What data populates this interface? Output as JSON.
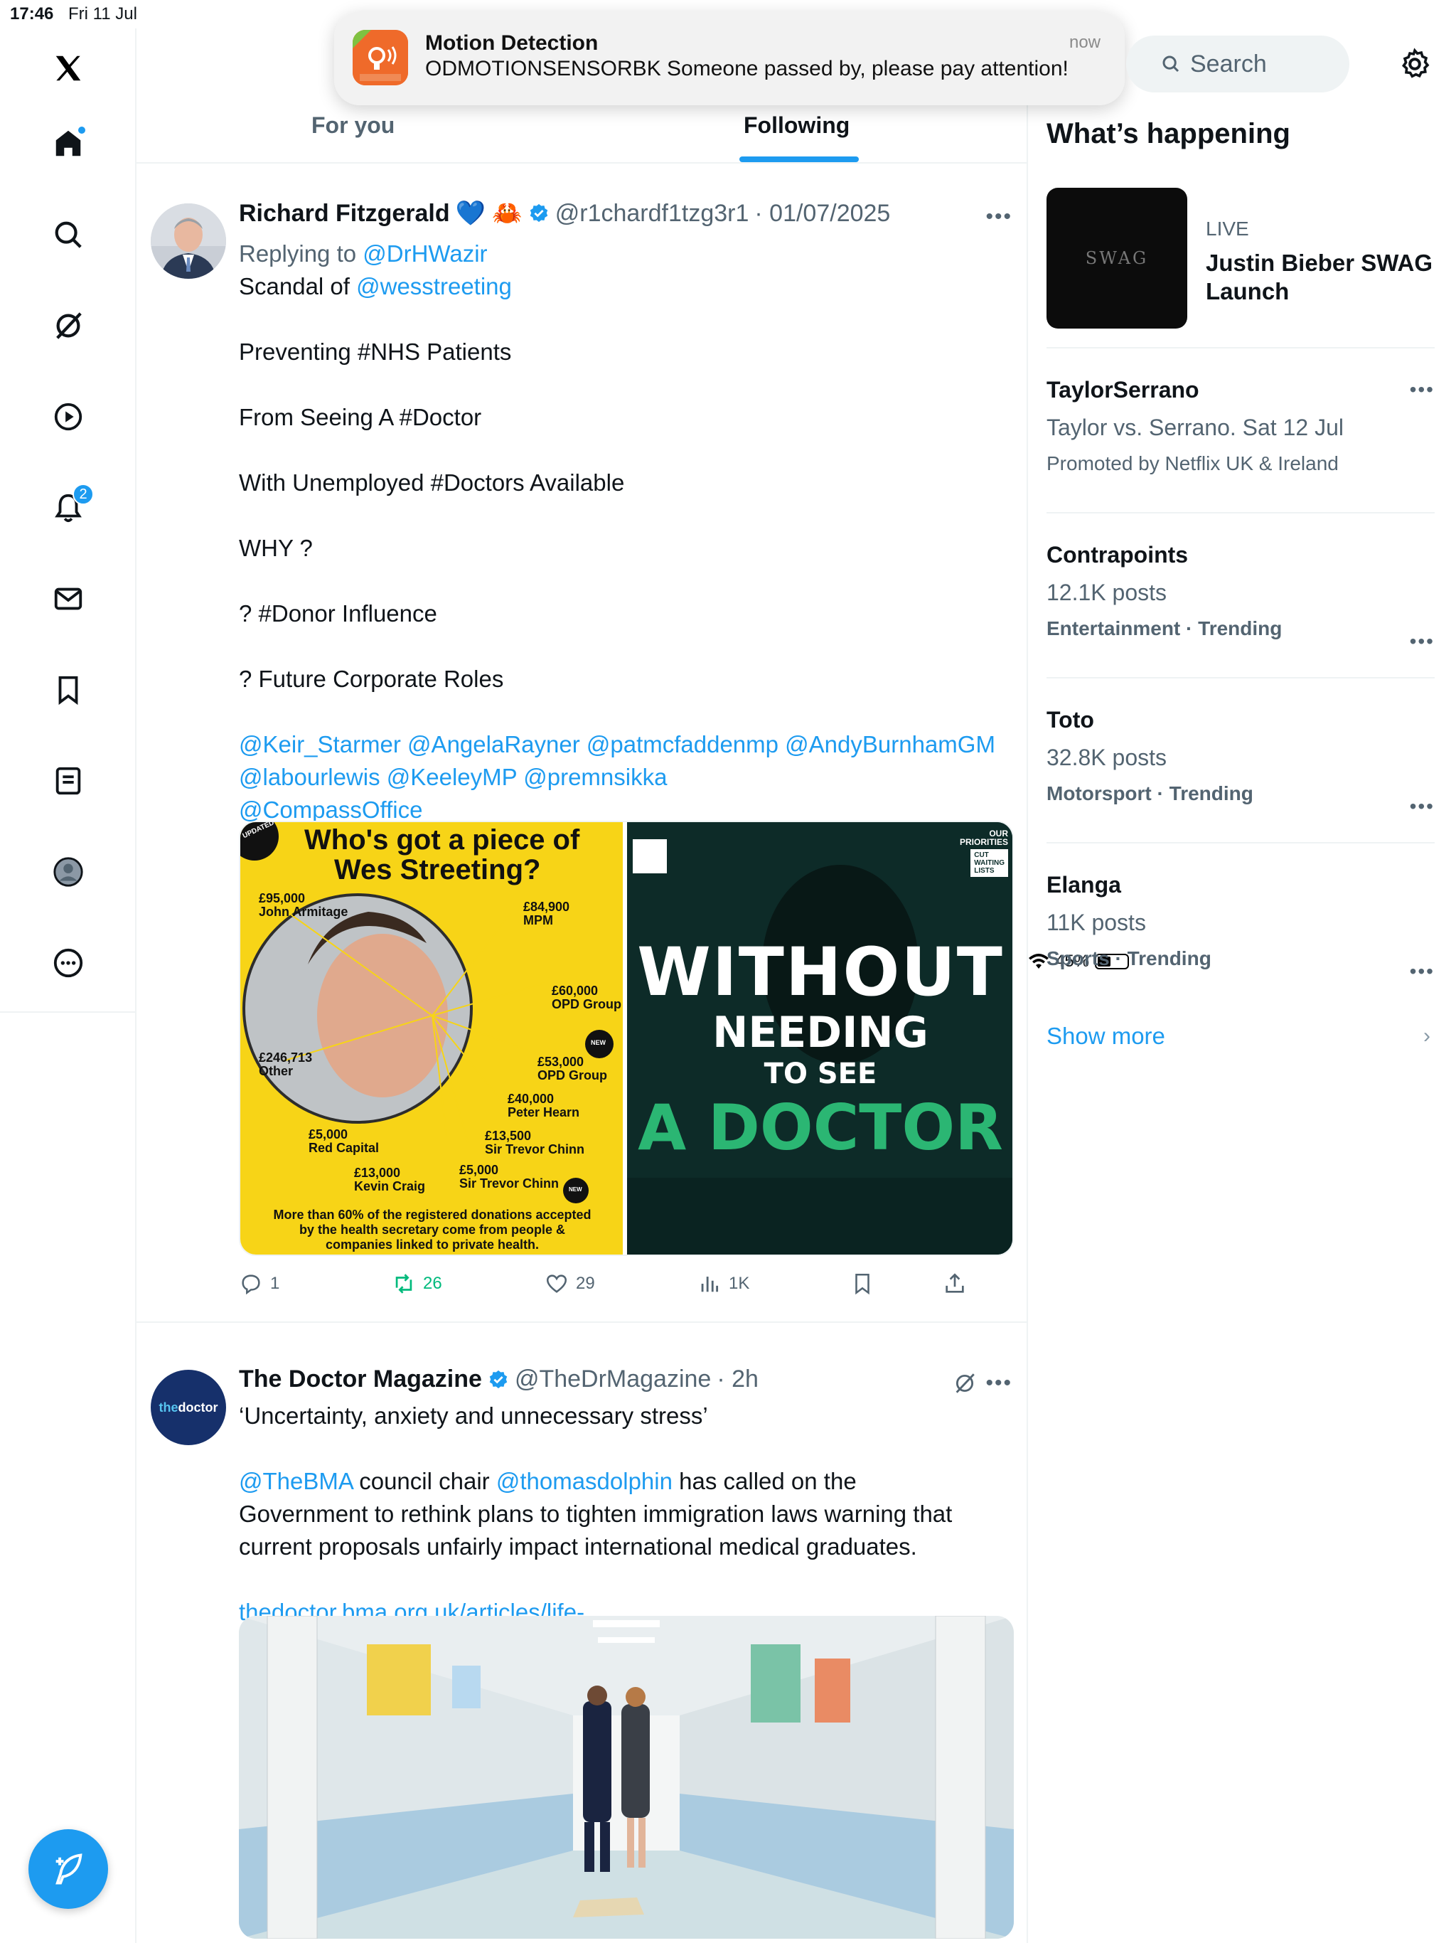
{
  "status_bar": {
    "time": "17:46",
    "date": "Fri 11 Jul",
    "battery": "45%",
    "battery_level": 0.45
  },
  "notification": {
    "title": "Motion Detection",
    "body": "ODMOTIONSENSORBK Someone passed by, please pay attention!",
    "time": "now"
  },
  "nav": {
    "items": [
      "x-logo",
      "home",
      "explore",
      "grok",
      "video",
      "notifications",
      "messages",
      "bookmarks",
      "lists",
      "profile",
      "more"
    ],
    "notifications_count": "2"
  },
  "tabs": [
    {
      "label": "For you",
      "active": false
    },
    {
      "label": "Following",
      "active": true
    }
  ],
  "tweet1": {
    "name": "Richard Fitzgerald",
    "emoji": "💙 🦀",
    "handle": "@r1chardf1tzg3r1",
    "date": "· 01/07/2025",
    "replying_label": "Replying to",
    "replying_to": "@DrHWazir",
    "line1_prefix": "Scandal of",
    "line1_mention": "@wesstreeting",
    "line2": "Preventing #NHS Patients",
    "line3": "From Seeing A #Doctor",
    "line4": "With Unemployed #Doctors Available",
    "line5": "WHY ?",
    "line6": "? #Donor Influence",
    "line7": "? Future Corporate Roles",
    "mentions_line1": "@Keir_Starmer @AngelaRayner @patmcfaddenmp @AndyBurnhamGM",
    "mentions_line2": "@labourlewis @KeeleyMP @premnsikka",
    "mentions_line3": "@CompassOffice",
    "image_left": {
      "tag": "UPDATED",
      "title_line1": "Who's got a piece of",
      "title_line2": "Wes Streeting?",
      "labels": [
        {
          "amount": "£95,000",
          "who": "John Armitage"
        },
        {
          "amount": "£84,900",
          "who": "MPM"
        },
        {
          "amount": "£60,000",
          "who": "OPD Group"
        },
        {
          "amount": "£246,713",
          "who": "Other"
        },
        {
          "amount": "£53,000",
          "who": "OPD Group"
        },
        {
          "amount": "£40,000",
          "who": "Peter Hearn"
        },
        {
          "amount": "£5,000",
          "who": "Red Capital"
        },
        {
          "amount": "£13,500",
          "who": "Sir Trevor Chinn"
        },
        {
          "amount": "£13,000",
          "who": "Kevin Craig"
        },
        {
          "amount": "£5,000",
          "who": "Sir Trevor Chinn"
        }
      ],
      "new_tag": "NEW",
      "footer_line1": "More than 60% of the registered donations accepted",
      "footer_line2": "by the health secretary come from people &",
      "footer_line3": "companies linked to private health."
    },
    "image_right": {
      "corner_line1": "OUR",
      "corner_line2": "PRIORITIES",
      "corner_line3": "CUT",
      "corner_line4": "WAITING",
      "corner_line5": "LISTS",
      "line1": "WITHOUT",
      "line2": "NEEDING",
      "line3": "TO SEE",
      "line4": "A DOCTOR"
    },
    "replies": "1",
    "reposts": "26",
    "likes": "29",
    "views": "1K"
  },
  "tweet2": {
    "name": "The Doctor Magazine",
    "handle": "@TheDrMagazine",
    "time": "· 2h",
    "avatar_text_a": "the",
    "avatar_text_b": "doctor",
    "line1": "‘Uncertainty, anxiety and unnecessary stress’",
    "mention1": "@TheBMA",
    "text_a": " council chair ",
    "mention2": "@thomasdolphin",
    "text_b": " has called on the",
    "line3": "Government to rethink plans to tighten immigration laws warning that",
    "line4": "current proposals unfairly impact international medical graduates.",
    "link": "thedoctor.bma.org.uk/articles/life-..."
  },
  "right": {
    "search_placeholder": "Search",
    "heading": "What’s happening",
    "live": {
      "tag": "LIVE",
      "title": "Justin Bieber SWAG Launch",
      "thumb_text": "SWAG"
    },
    "trends": [
      {
        "title": "TaylorSerrano",
        "subtitle": "Taylor vs. Serrano. Sat 12 Jul",
        "meta": "Promoted by Netflix UK & Ireland"
      },
      {
        "title": "Contrapoints",
        "subtitle": "12.1K posts",
        "meta_a": "Entertainment",
        "meta_b": "· Trending"
      },
      {
        "title": "Toto",
        "subtitle": "32.8K posts",
        "meta_a": "Motorsport",
        "meta_b": "· Trending"
      },
      {
        "title": "Elanga",
        "subtitle": "11K posts",
        "meta_a": "Sports",
        "meta_b": "· Trending"
      }
    ],
    "show_more": "Show more"
  },
  "colors": {
    "accent": "#1d9bf0",
    "text": "#0f1419",
    "muted": "#536471",
    "repost_green": "#00ba7c",
    "yellow_card": "#f7d417",
    "teal_card": "#0e2f2c"
  }
}
